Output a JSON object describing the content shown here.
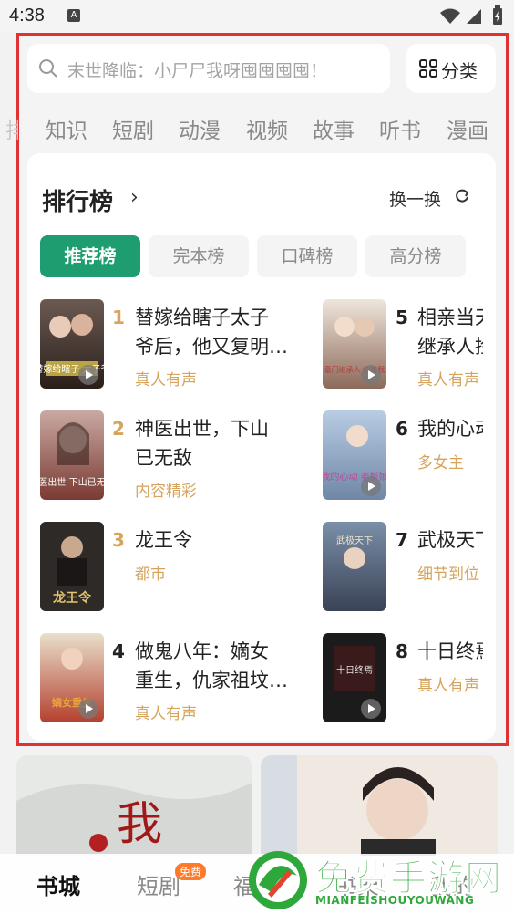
{
  "status_bar": {
    "time": "4:38",
    "notif_glyph": "A"
  },
  "search": {
    "placeholder": "末世降临：小尸尸我呀囤囤囤囤！"
  },
  "category_button": {
    "label": "分类"
  },
  "top_tabs": {
    "items": [
      {
        "label": "知识"
      },
      {
        "label": "短剧"
      },
      {
        "label": "动漫"
      },
      {
        "label": "视频"
      },
      {
        "label": "故事"
      },
      {
        "label": "听书"
      },
      {
        "label": "漫画"
      }
    ]
  },
  "ranking": {
    "title": "排行榜",
    "refresh_label": "换一换",
    "pills": [
      {
        "label": "推荐榜"
      },
      {
        "label": "完本榜"
      },
      {
        "label": "口碑榜"
      },
      {
        "label": "高分榜"
      }
    ],
    "items": [
      {
        "rank": "1",
        "title_line1": "替嫁给瞎子太子",
        "title_line2": "爷后，他又复明…",
        "tag": "真人有声"
      },
      {
        "rank": "2",
        "title_line1": "神医出世，下山",
        "title_line2": "已无敌",
        "tag": "内容精彩"
      },
      {
        "rank": "3",
        "title_line1": "龙王令",
        "title_line2": "",
        "tag": "都市"
      },
      {
        "rank": "4",
        "title_line1": "做鬼八年：嫡女",
        "title_line2": "重生，仇家祖坟…",
        "tag": "真人有声"
      },
      {
        "rank": "5",
        "title_line1": "相亲当天",
        "title_line2": "继承人捡",
        "tag": "真人有声"
      },
      {
        "rank": "6",
        "title_line1": "我的心动",
        "title_line2": "",
        "tag": "多女主"
      },
      {
        "rank": "7",
        "title_line1": "武极天下",
        "title_line2": "",
        "tag": "细节到位"
      },
      {
        "rank": "8",
        "title_line1": "十日终焉",
        "title_line2": "",
        "tag": "真人有声"
      }
    ],
    "cover_texts": [
      "替嫁给瞎子 太子爷",
      "神医出世 下山已无敌",
      "龙王令",
      "嫡女重生",
      "豪门继承人 拉着我",
      "我的心动 老板娘",
      "武极天下",
      "十日终焉"
    ]
  },
  "banner_text": "我",
  "bottom_nav": {
    "items": [
      {
        "label": "书城"
      },
      {
        "label": "短剧"
      },
      {
        "label": "福利"
      },
      {
        "label": "书架"
      },
      {
        "label": "我的"
      }
    ],
    "badge": "免费"
  },
  "watermark": {
    "text": "免费手游网",
    "sub": "MIANFEISHOUYOUWANG"
  },
  "colors": {
    "accent": "#1e9e70",
    "tag": "#d6a45c",
    "frame": "#e03232",
    "rank_top": "#d6a45c"
  }
}
